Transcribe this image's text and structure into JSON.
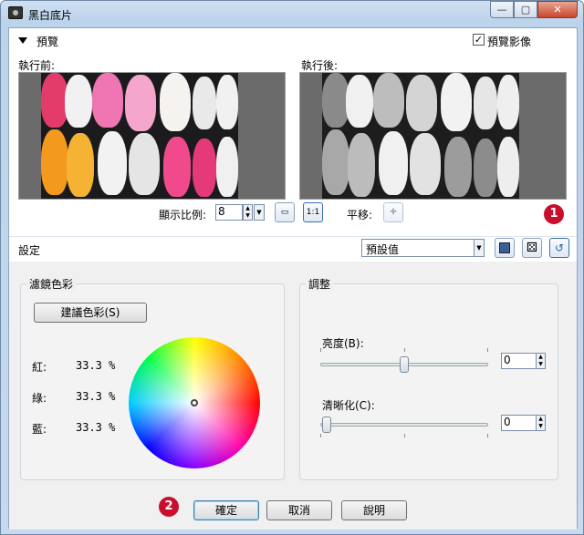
{
  "window": {
    "title": "黑白底片"
  },
  "preview": {
    "title": "預覽",
    "show_preview_label": "預覽影像",
    "show_preview_checked": true,
    "before_label": "執行前:",
    "after_label": "執行後:",
    "zoom_label": "顯示比例:",
    "zoom_value": "8",
    "pan_label": "平移:"
  },
  "settings": {
    "title": "設定",
    "preset_value": "預設值"
  },
  "filter_color": {
    "title": "濾鏡色彩",
    "suggest_button": "建議色彩(S)",
    "red_label": "紅:",
    "red_value": "33.3 %",
    "green_label": "綠:",
    "green_value": "33.3 %",
    "blue_label": "藍:",
    "blue_value": "33.3 %"
  },
  "adjust": {
    "title": "調整",
    "brightness_label": "亮度(B):",
    "brightness_value": "0",
    "sharpen_label": "清晰化(C):",
    "sharpen_value": "0"
  },
  "footer": {
    "ok": "確定",
    "cancel": "取消",
    "help": "說明"
  },
  "badges": {
    "one": "1",
    "two": "2"
  },
  "colors": {
    "badge": "#c8102e",
    "window_frame": "#bcd3ec"
  }
}
